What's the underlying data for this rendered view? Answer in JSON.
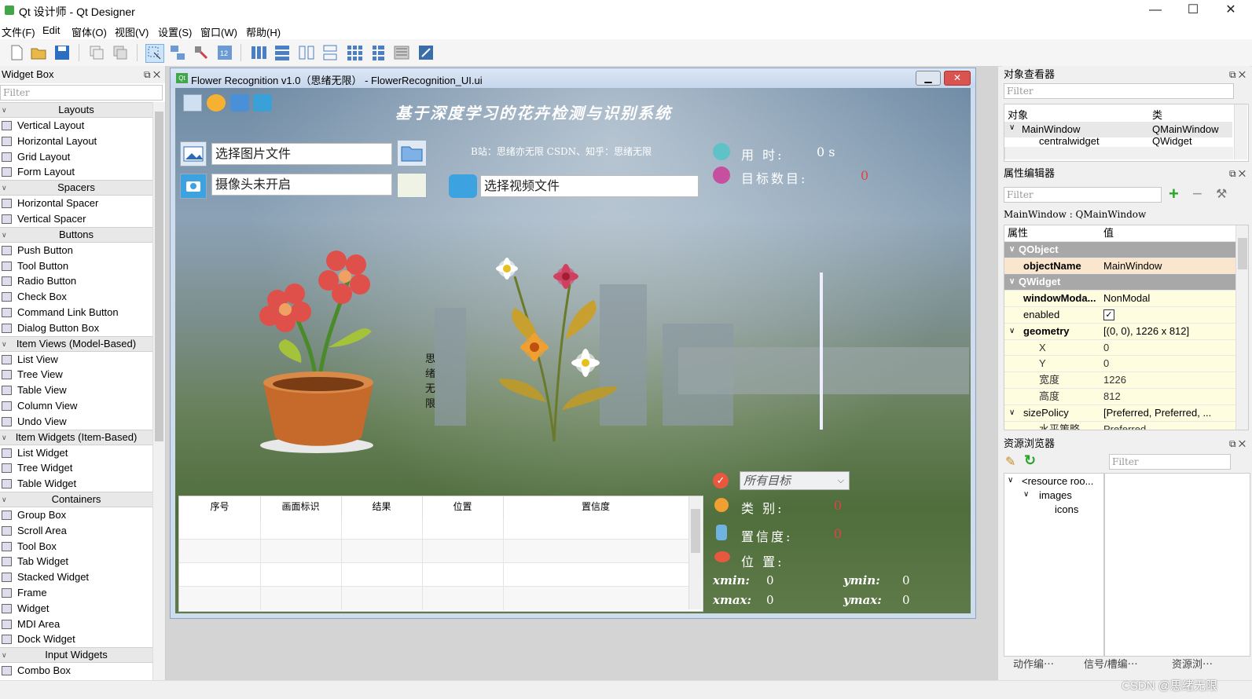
{
  "app": {
    "title": "Qt 设计师 - Qt Designer",
    "window_controls": {
      "minimize": "—",
      "maximize": "☐",
      "close": "✕"
    }
  },
  "menubar": [
    "文件(F)",
    "Edit",
    "窗体(O)",
    "视图(V)",
    "设置(S)",
    "窗口(W)",
    "帮助(H)"
  ],
  "widget_box": {
    "title": "Widget Box",
    "filter_placeholder": "Filter",
    "categories": [
      {
        "name": "Layouts",
        "items": [
          "Vertical Layout",
          "Horizontal Layout",
          "Grid Layout",
          "Form Layout"
        ]
      },
      {
        "name": "Spacers",
        "items": [
          "Horizontal Spacer",
          "Vertical Spacer"
        ]
      },
      {
        "name": "Buttons",
        "items": [
          "Push Button",
          "Tool Button",
          "Radio Button",
          "Check Box",
          "Command Link Button",
          "Dialog Button Box"
        ]
      },
      {
        "name": "Item Views (Model-Based)",
        "items": [
          "List View",
          "Tree View",
          "Table View",
          "Column View",
          "Undo View"
        ]
      },
      {
        "name": "Item Widgets (Item-Based)",
        "items": [
          "List Widget",
          "Tree Widget",
          "Table Widget"
        ]
      },
      {
        "name": "Containers",
        "items": [
          "Group Box",
          "Scroll Area",
          "Tool Box",
          "Tab Widget",
          "Stacked Widget",
          "Frame",
          "Widget",
          "MDI Area",
          "Dock Widget"
        ]
      },
      {
        "name": "Input Widgets",
        "items": [
          "Combo Box"
        ]
      }
    ]
  },
  "form": {
    "window_title": "Flower Recognition v1.0（思绪无限） - FlowerRecognition_UI.ui",
    "qt_badge": "Qt",
    "main_title": "基于深度学习的花卉检测与识别系统",
    "select_image": "选择图片文件",
    "camera_status": "摄像头未开启",
    "select_video": "选择视频文件",
    "credits": "B站：思绪亦无限  CSDN、知乎：思绪无限",
    "time_label": "用 时:",
    "time_value": "0 s",
    "target_count_label": "目标数目:",
    "target_count_value": "0",
    "vertical_text": [
      "思",
      "绪",
      "无",
      "限"
    ],
    "table_headers": [
      "序号",
      "画面标识",
      "结果",
      "位置",
      "置信度"
    ],
    "target_combo": "所有目标",
    "class_label": "类 别:",
    "class_value": "0",
    "confidence_label": "置信度:",
    "confidence_value": "0",
    "position_label": "位 置:",
    "xmin_label": "xmin:",
    "xmin_value": "0",
    "ymin_label": "ymin:",
    "ymin_value": "0",
    "xmax_label": "xmax:",
    "xmax_value": "0",
    "ymax_label": "ymax:",
    "ymax_value": "0"
  },
  "object_inspector": {
    "title": "对象查看器",
    "filter_placeholder": "Filter",
    "col_object": "对象",
    "col_class": "类",
    "rows": [
      {
        "object": "MainWindow",
        "class": "QMainWindow"
      },
      {
        "object": "centralwidget",
        "class": "QWidget"
      }
    ]
  },
  "property_editor": {
    "title": "属性编辑器",
    "filter_placeholder": "Filter",
    "context": "MainWindow : QMainWindow",
    "col_property": "属性",
    "col_value": "值",
    "rows": [
      {
        "key": "QObject",
        "value": "",
        "kind": "group"
      },
      {
        "key": "objectName",
        "value": "MainWindow",
        "kind": "orange-bold"
      },
      {
        "key": "QWidget",
        "value": "",
        "kind": "group"
      },
      {
        "key": "windowModa...",
        "value": "NonModal",
        "kind": "yellow-bold"
      },
      {
        "key": "enabled",
        "value": "✓",
        "kind": "yellow"
      },
      {
        "key": "geometry",
        "value": "[(0, 0), 1226 x 812]",
        "kind": "yellow-bold"
      },
      {
        "key": "X",
        "value": "0",
        "kind": "yellow-sub"
      },
      {
        "key": "Y",
        "value": "0",
        "kind": "yellow-sub"
      },
      {
        "key": "宽度",
        "value": "1226",
        "kind": "yellow-sub"
      },
      {
        "key": "高度",
        "value": "812",
        "kind": "yellow-sub"
      },
      {
        "key": "sizePolicy",
        "value": "[Preferred, Preferred, ...",
        "kind": "yellow"
      },
      {
        "key": "水平策略",
        "value": "Preferred",
        "kind": "yellow-sub"
      }
    ]
  },
  "resource_browser": {
    "title": "资源浏览器",
    "filter_placeholder": "Filter",
    "tree": [
      "<resource roo...",
      "images",
      "icons"
    ]
  },
  "bottom_tabs": [
    "动作编⋯",
    "信号/槽编⋯",
    "资源浏⋯"
  ],
  "watermark": "CSDN @思绪无限",
  "colors": {
    "accent": "#1e6fc8",
    "group_gray": "#a8a8a8",
    "prop_yellow": "#fffde0",
    "prop_orange": "#f9e6cc"
  }
}
